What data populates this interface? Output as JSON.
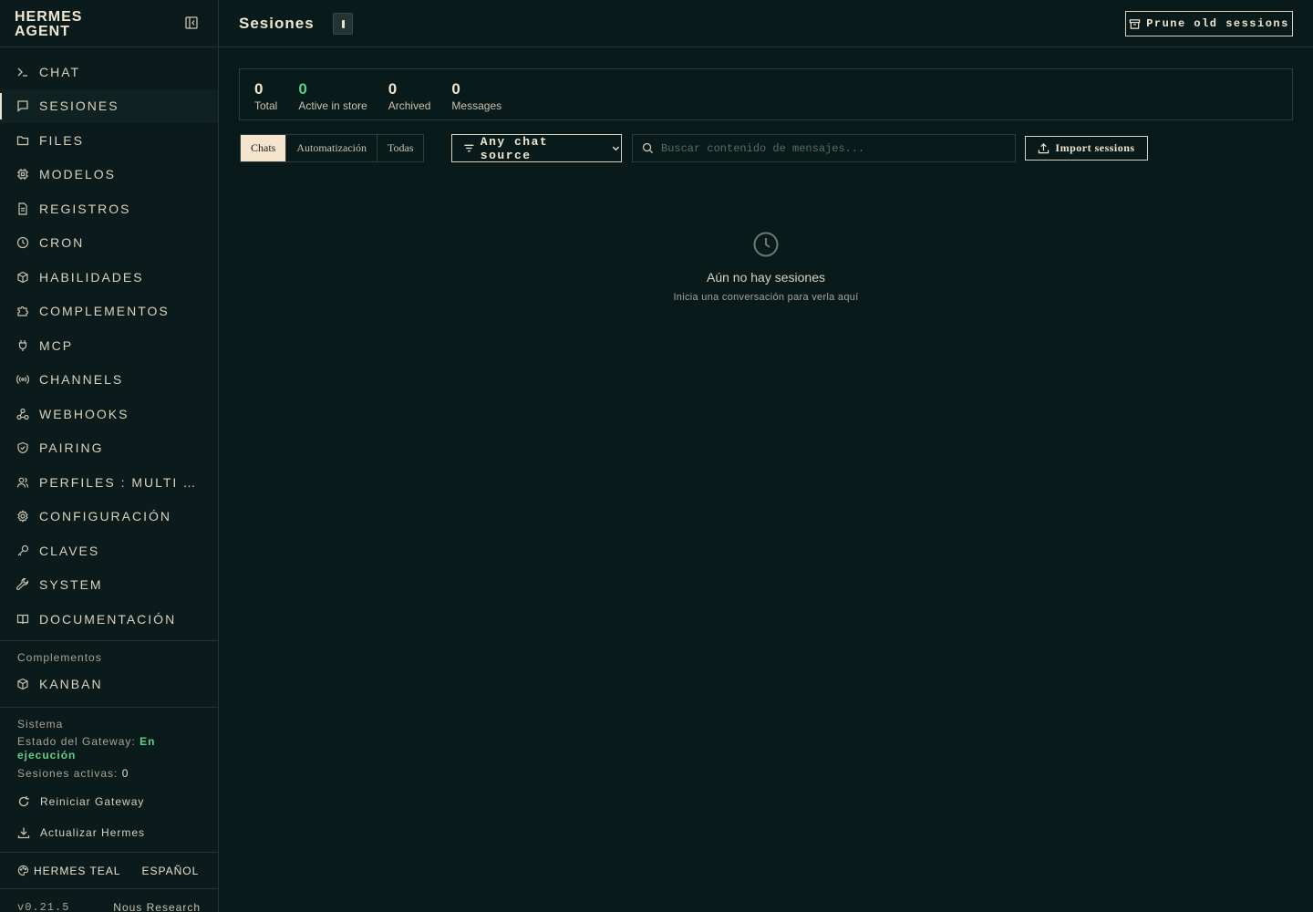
{
  "brand": {
    "name": "HERMES\nAGENT"
  },
  "sidebar": {
    "nav": [
      {
        "label": "CHAT",
        "icon": "terminal-icon",
        "active": false
      },
      {
        "label": "SESIONES",
        "icon": "chat-bubble-icon",
        "active": true
      },
      {
        "label": "FILES",
        "icon": "folder-icon",
        "active": false
      },
      {
        "label": "MODELOS",
        "icon": "cpu-icon",
        "active": false
      },
      {
        "label": "REGISTROS",
        "icon": "document-icon",
        "active": false
      },
      {
        "label": "CRON",
        "icon": "clock-icon",
        "active": false
      },
      {
        "label": "HABILIDADES",
        "icon": "package-icon",
        "active": false
      },
      {
        "label": "COMPLEMENTOS",
        "icon": "puzzle-icon",
        "active": false
      },
      {
        "label": "MCP",
        "icon": "plug-icon",
        "active": false
      },
      {
        "label": "CHANNELS",
        "icon": "broadcast-icon",
        "active": false
      },
      {
        "label": "WEBHOOKS",
        "icon": "webhook-icon",
        "active": false
      },
      {
        "label": "PAIRING",
        "icon": "shield-icon",
        "active": false
      },
      {
        "label": "PERFILES : MULTI AGENTE",
        "icon": "users-icon",
        "active": false
      },
      {
        "label": "CONFIGURACIÓN",
        "icon": "gear-icon",
        "active": false
      },
      {
        "label": "CLAVES",
        "icon": "key-icon",
        "active": false
      },
      {
        "label": "SYSTEM",
        "icon": "wrench-icon",
        "active": false
      },
      {
        "label": "DOCUMENTACIÓN",
        "icon": "book-icon",
        "active": false
      }
    ],
    "plugins": {
      "title": "Complementos",
      "items": [
        {
          "label": "KANBAN",
          "icon": "package-icon"
        }
      ]
    },
    "system": {
      "title": "Sistema",
      "gateway_label": "Estado del Gateway:",
      "gateway_status": "En ejecución",
      "sessions_label": "Sesiones activas:",
      "sessions_value": "0",
      "actions": [
        {
          "label": "Reiniciar Gateway",
          "icon": "refresh-icon"
        },
        {
          "label": "Actualizar Hermes",
          "icon": "download-icon"
        }
      ]
    },
    "theme": "HERMES TEAL",
    "language": "ESPAÑOL",
    "version": "v0.21.5",
    "vendor": "Nous Research"
  },
  "header": {
    "title": "Sesiones",
    "prune_label": "Prune old sessions"
  },
  "stats": [
    {
      "value": "0",
      "label": "Total"
    },
    {
      "value": "0",
      "label": "Active in store"
    },
    {
      "value": "0",
      "label": "Archived"
    },
    {
      "value": "0",
      "label": "Messages"
    }
  ],
  "filters": {
    "tabs": [
      "Chats",
      "Automatización",
      "Todas"
    ],
    "source": "Any chat source",
    "search_placeholder": "Buscar contenido de mensajes...",
    "import_label": "Import sessions"
  },
  "empty": {
    "title": "Aún no hay sesiones",
    "subtitle": "Inicia una conversación para verla aquí"
  },
  "colors": {
    "accent_green": "#5fd08a",
    "background": "#091a1a",
    "text": "#e8e2d0"
  }
}
